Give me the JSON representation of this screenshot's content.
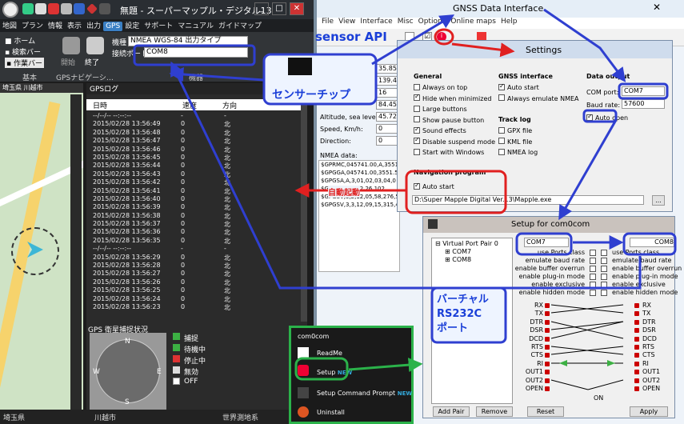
{
  "mapple": {
    "title": "無題 - スーパーマップル・デジタル13",
    "menu": [
      "地図",
      "プラン",
      "情報",
      "表示",
      "出力",
      "GPS",
      "設定",
      "サポート",
      "マニュアル",
      "ガイドマップ"
    ],
    "menu_active": "GPS",
    "ribbon": {
      "home": "ホーム",
      "search_bar": "検索バー",
      "work_bar": "作業バー",
      "start": "開始",
      "end": "終了",
      "model_label": "機種",
      "model_value": "NMEA WGS-84 出力タイプ",
      "port_label": "接続ポート",
      "port_value": "COM8",
      "group_basic": "基本",
      "group_nav": "GPSナビゲーシ…",
      "group_device": "機器"
    },
    "map_labels": {
      "pref": "埼玉県",
      "city": "川越市"
    },
    "gps_log": {
      "title": "GPSログ",
      "cols": [
        "日時",
        "速度",
        "方向"
      ],
      "rows": [
        [
          "--/--/-- --:--:--",
          "-",
          "-"
        ],
        [
          "2015/02/28 13:56:49",
          "0",
          "北"
        ],
        [
          "2015/02/28 13:56:48",
          "0",
          "北"
        ],
        [
          "2015/02/28 13:56:47",
          "0",
          "北"
        ],
        [
          "2015/02/28 13:56:46",
          "0",
          "北"
        ],
        [
          "2015/02/28 13:56:45",
          "0",
          "北"
        ],
        [
          "2015/02/28 13:56:44",
          "0",
          "北"
        ],
        [
          "2015/02/28 13:56:43",
          "0",
          "北"
        ],
        [
          "2015/02/28 13:56:42",
          "0",
          "北"
        ],
        [
          "2015/02/28 13:56:41",
          "0",
          "北"
        ],
        [
          "2015/02/28 13:56:40",
          "0",
          "北"
        ],
        [
          "2015/02/28 13:56:39",
          "0",
          "北"
        ],
        [
          "2015/02/28 13:56:38",
          "0",
          "北"
        ],
        [
          "2015/02/28 13:56:37",
          "0",
          "北"
        ],
        [
          "2015/02/28 13:56:36",
          "0",
          "北"
        ],
        [
          "2015/02/28 13:56:35",
          "0",
          "北"
        ],
        [
          "--/--/-- --:--:--",
          "-",
          "-"
        ],
        [
          "2015/02/28 13:56:29",
          "0",
          "北"
        ],
        [
          "2015/02/28 13:56:28",
          "0",
          "北"
        ],
        [
          "2015/02/28 13:56:27",
          "0",
          "北"
        ],
        [
          "2015/02/28 13:56:26",
          "0",
          "北"
        ],
        [
          "2015/02/28 13:56:25",
          "0",
          "北"
        ],
        [
          "2015/02/28 13:56:24",
          "0",
          "北"
        ],
        [
          "2015/02/28 13:56:23",
          "0",
          "北"
        ]
      ]
    },
    "sat": {
      "title": "GPS 衛星捕捉状況",
      "legend": [
        "捕捉",
        "待機中",
        "停止中",
        "無効",
        "OFF"
      ],
      "legend_colors": [
        "#3cb043",
        "#3cb043",
        "#d33",
        "#ddd",
        "#fff"
      ],
      "compass": [
        "N",
        "E",
        "S",
        "W"
      ]
    },
    "status": {
      "pref": "埼玉県",
      "city": "川越市",
      "datum": "世界測地系"
    }
  },
  "gnss": {
    "title": "GNSS Data Interface",
    "menu": [
      "File",
      "View",
      "Interface",
      "Misc",
      "Options",
      "Online maps",
      "Help"
    ],
    "api_tab": "sensor API",
    "fields": [
      [
        "",
        "35.85"
      ],
      [
        "",
        "139.4"
      ],
      [
        "",
        "16"
      ],
      [
        "",
        "84.45"
      ],
      [
        "Altitude, sea level:",
        "45.72"
      ],
      [
        "Speed, Km/h:",
        "0"
      ],
      [
        "Direction:",
        "0"
      ]
    ],
    "nmea_label": "NMEA data:",
    "nmea_lines": [
      "$GPRMC,045741.00,A,3551.",
      "$GPGGA,045741.00,3551.5",
      "$GPGSA,A,3,01,02,03,04,0",
      "$GPGSV,3,1,12,26,102,",
      "$GPGSV,3,2,12,05,58,276,5",
      "$GPGSV,3,3,12,09,15,315,4"
    ]
  },
  "settings": {
    "title": "Settings",
    "general_title": "General",
    "general": [
      [
        "Always on top",
        false
      ],
      [
        "Hide when minimized",
        true
      ],
      [
        "Large buttons",
        false
      ],
      [
        "Show pause button",
        false
      ],
      [
        "Sound effects",
        true
      ],
      [
        "Disable suspend mode",
        true
      ],
      [
        "Start with Windows",
        false
      ]
    ],
    "gnss_iface_title": "GNSS interface",
    "gnss_iface": [
      [
        "Auto start",
        true
      ],
      [
        "Always emulate NMEA",
        false
      ]
    ],
    "track_title": "Track log",
    "track": [
      [
        "GPX file",
        false
      ],
      [
        "KML file",
        false
      ],
      [
        "NMEA log",
        false
      ]
    ],
    "data_out_title": "Data output",
    "com_port_label": "COM port:",
    "com_port_value": "COM7",
    "baud_label": "Baud rate:",
    "baud_value": "57600",
    "auto_open": "Auto open",
    "nav_title": "Navigation program",
    "nav_auto_start": "Auto start",
    "nav_path": "D:\\Super Mapple Digital Ver.13\\Mapple.exe",
    "browse": "..."
  },
  "setup": {
    "title": "Setup for com0com",
    "tree": [
      "Virtual Port Pair 0",
      "COM7",
      "COM8"
    ],
    "port_a": "COM7",
    "port_b": "COM8",
    "opts": [
      "use Ports class",
      "emulate baud rate",
      "enable buffer overrun",
      "enable plug-in mode",
      "enable exclusive",
      "enable hidden mode"
    ],
    "pins_left": [
      "RX",
      "TX",
      "DTR",
      "DSR",
      "DCD",
      "RTS",
      "CTS",
      "RI",
      "OUT1",
      "OUT2",
      "OPEN"
    ],
    "pins_right": [
      "RX",
      "TX",
      "DTR",
      "DSR",
      "DCD",
      "RTS",
      "CTS",
      "RI",
      "OUT1",
      "OUT2",
      "OPEN"
    ],
    "on_label": "ON",
    "buttons": [
      "Add Pair",
      "Remove",
      "Reset",
      "Apply"
    ]
  },
  "com0com_menu": {
    "title": "com0com",
    "items": [
      "ReadMe",
      "Setup",
      "Setup Command Prompt",
      "Uninstall"
    ],
    "new_badge": "NEW"
  },
  "annotations": {
    "sensor_chip": "センサーチップ",
    "auto_start_ann": "自動起動",
    "virtual_port": "バーチャル\nRS232C\nポート"
  }
}
